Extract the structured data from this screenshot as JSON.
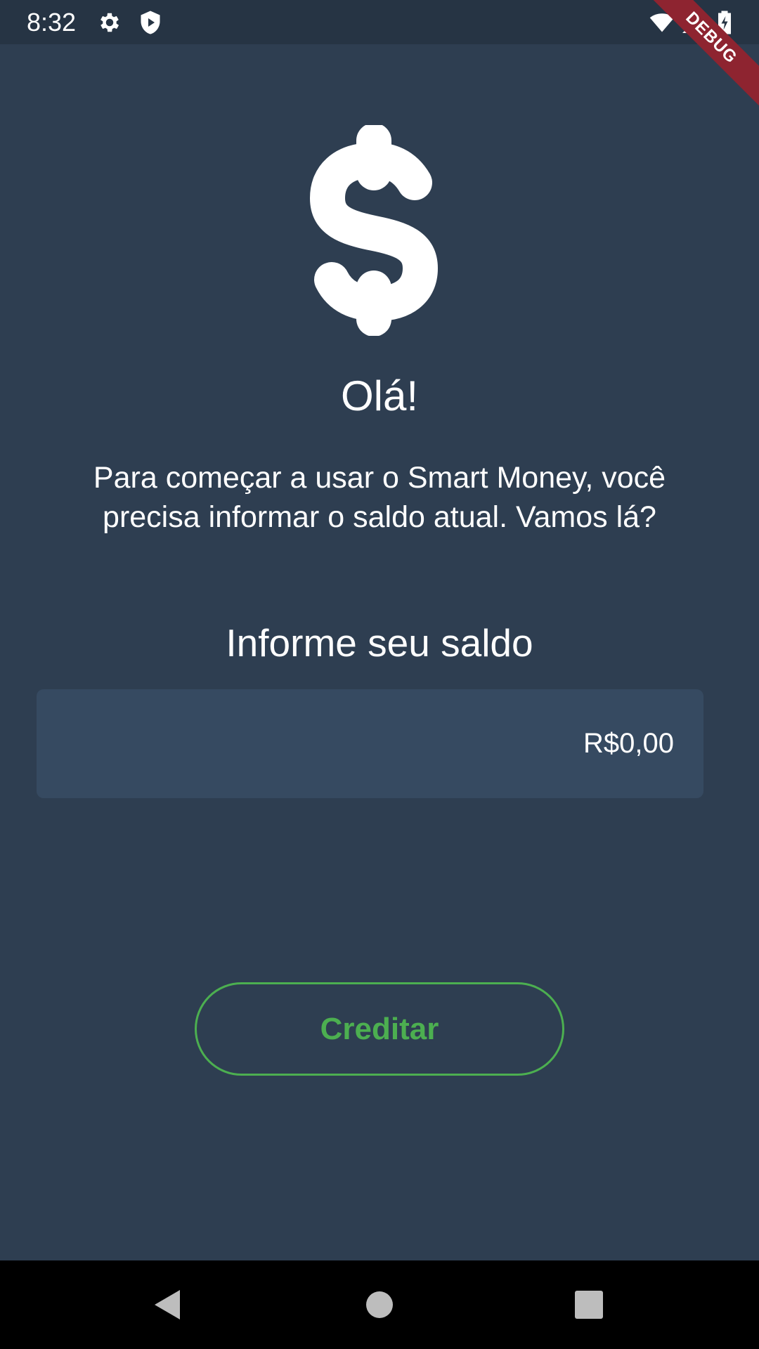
{
  "status_bar": {
    "time": "8:32",
    "icons": [
      "gear-icon",
      "shield-play-icon",
      "wifi-icon",
      "signal-icon",
      "battery-charging-icon"
    ]
  },
  "debug_banner": "DEBUG",
  "main": {
    "icon": "dollar-icon",
    "greeting": "Olá!",
    "intro": "Para começar a usar o Smart Money, você precisa informar o saldo atual. Vamos lá?",
    "balance_label": "Informe seu saldo",
    "balance_value": "R$0,00",
    "credit_button": "Creditar"
  },
  "nav_bar": {
    "icons": [
      "back-icon",
      "home-icon",
      "recents-icon"
    ]
  },
  "colors": {
    "background": "#2e3e51",
    "status_bar": "#263444",
    "field": "#364a61",
    "accent": "#4caf50",
    "debug": "#8e2430"
  }
}
